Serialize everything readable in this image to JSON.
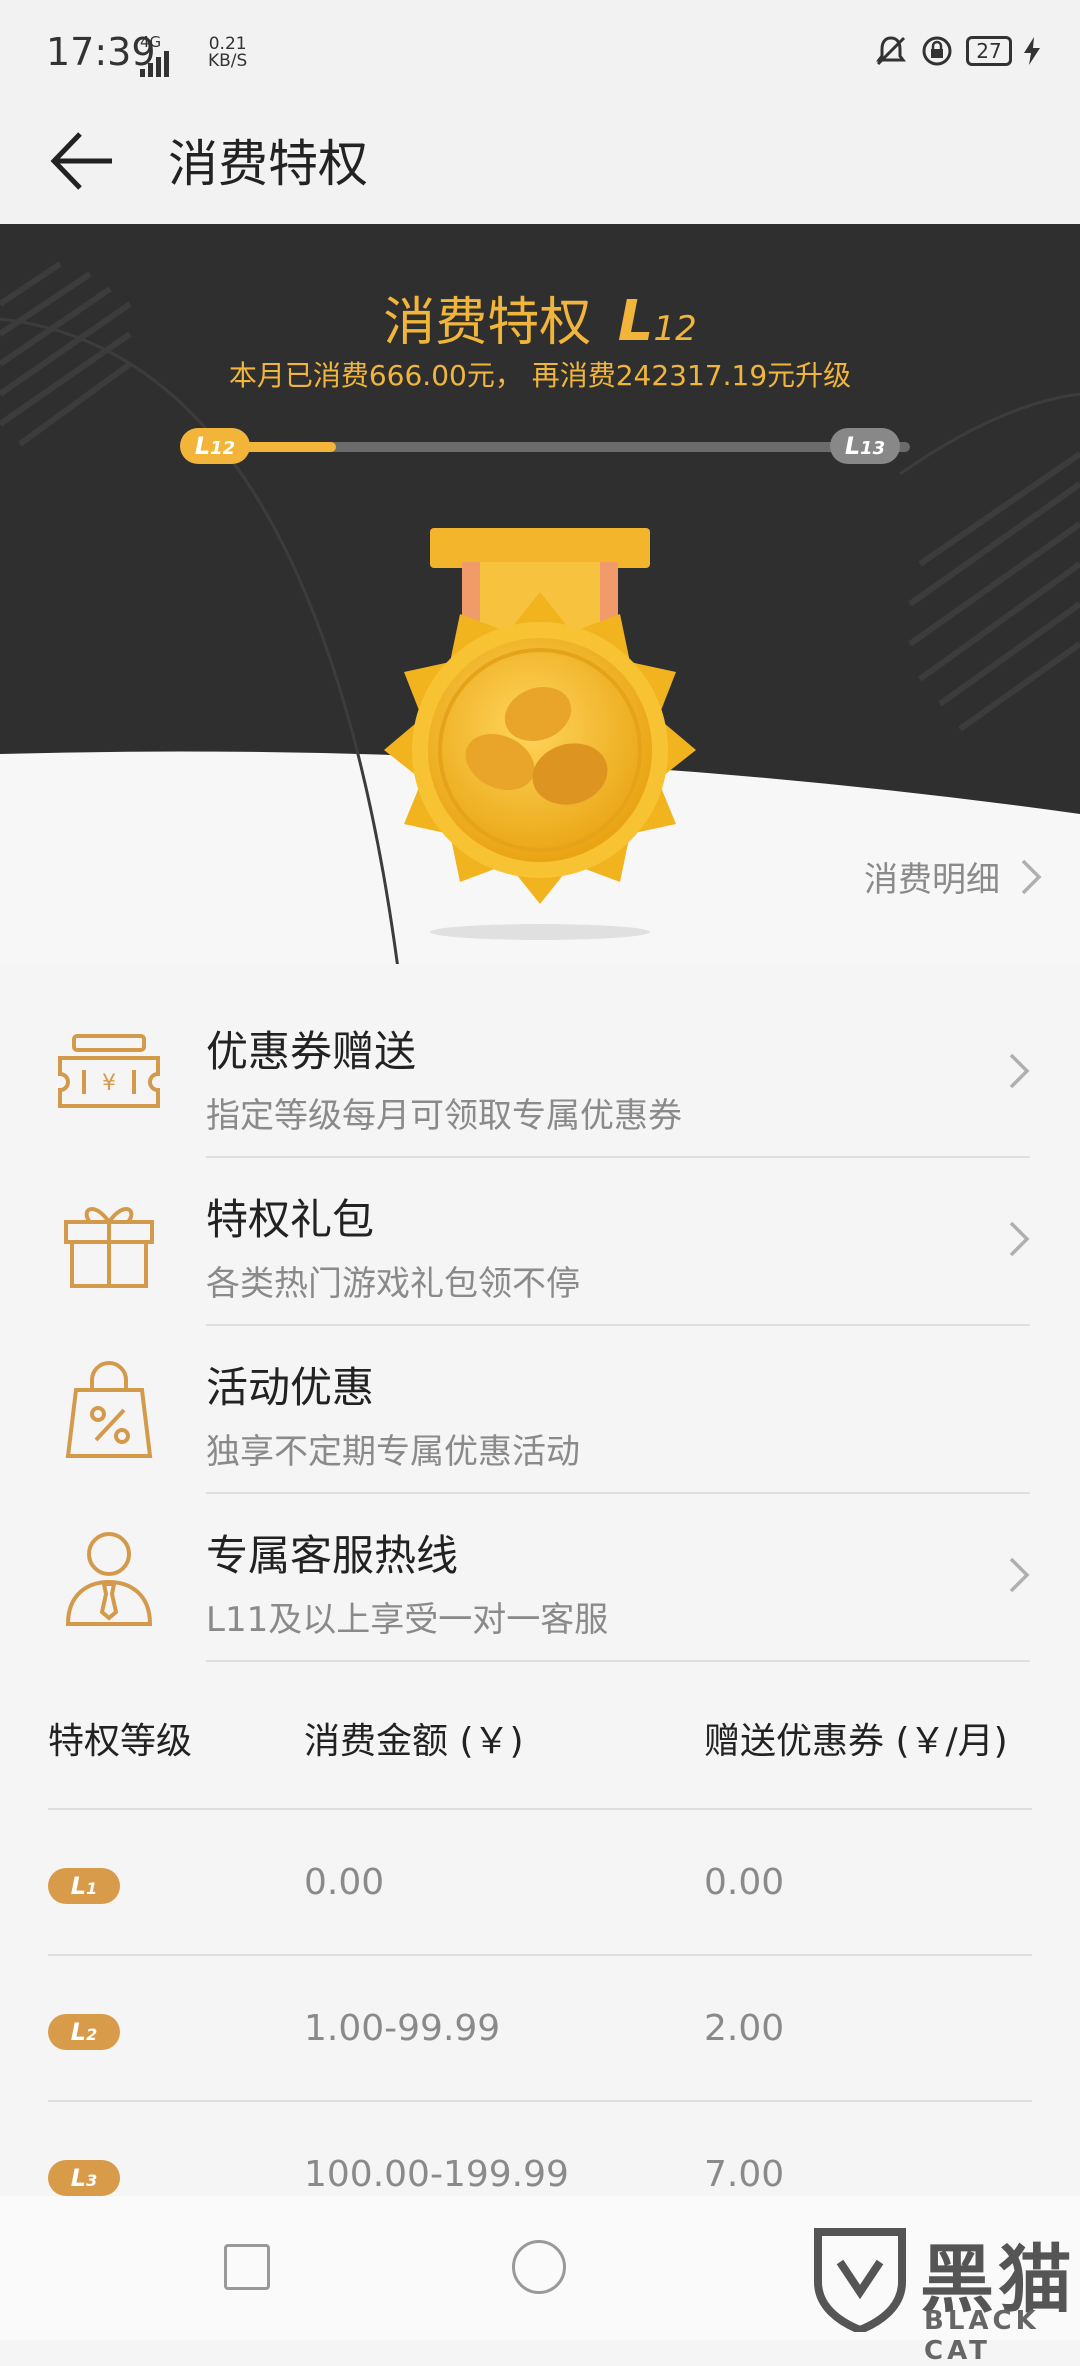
{
  "status": {
    "time": "17:39",
    "network": "4G",
    "speed_value": "0.21",
    "speed_unit": "KB/S",
    "battery": "27"
  },
  "appbar": {
    "title": "消费特权"
  },
  "hero": {
    "title": "消费特权",
    "level_prefix": "L",
    "level_num": "12",
    "summary": "本月已消费666.00元， 再消费242317.19元升级",
    "progress": 0.18,
    "current_prefix": "L",
    "current_num": "12",
    "next_prefix": "L",
    "next_num": "13",
    "detail_link": "消费明细",
    "colors": {
      "gold": "#f0b53a",
      "dark_bg": "#2f2f2f"
    }
  },
  "privileges": [
    {
      "icon": "coupon-icon",
      "title": "优惠券赠送",
      "desc": "指定等级每月可领取专属优惠券"
    },
    {
      "icon": "gift-icon",
      "title": "特权礼包",
      "desc": "各类热门游戏礼包领不停"
    },
    {
      "icon": "shopping-bag-percent-icon",
      "title": "活动优惠",
      "desc": "独享不定期专属优惠活动"
    },
    {
      "icon": "customer-service-icon",
      "title": "专属客服热线",
      "desc": "L11及以上享受一对一客服"
    }
  ],
  "table": {
    "headers": [
      "特权等级",
      "消费金额 (￥)",
      "赠送优惠券 (￥/月)"
    ],
    "rows": [
      {
        "level_prefix": "L",
        "level_num": "1",
        "amount": "0.00",
        "coupon": "0.00"
      },
      {
        "level_prefix": "L",
        "level_num": "2",
        "amount": "1.00-99.99",
        "coupon": "2.00"
      },
      {
        "level_prefix": "L",
        "level_num": "3",
        "amount": "100.00-199.99",
        "coupon": "7.00"
      }
    ]
  },
  "watermark": {
    "text": "黑猫",
    "sub": "BLACK CAT"
  }
}
